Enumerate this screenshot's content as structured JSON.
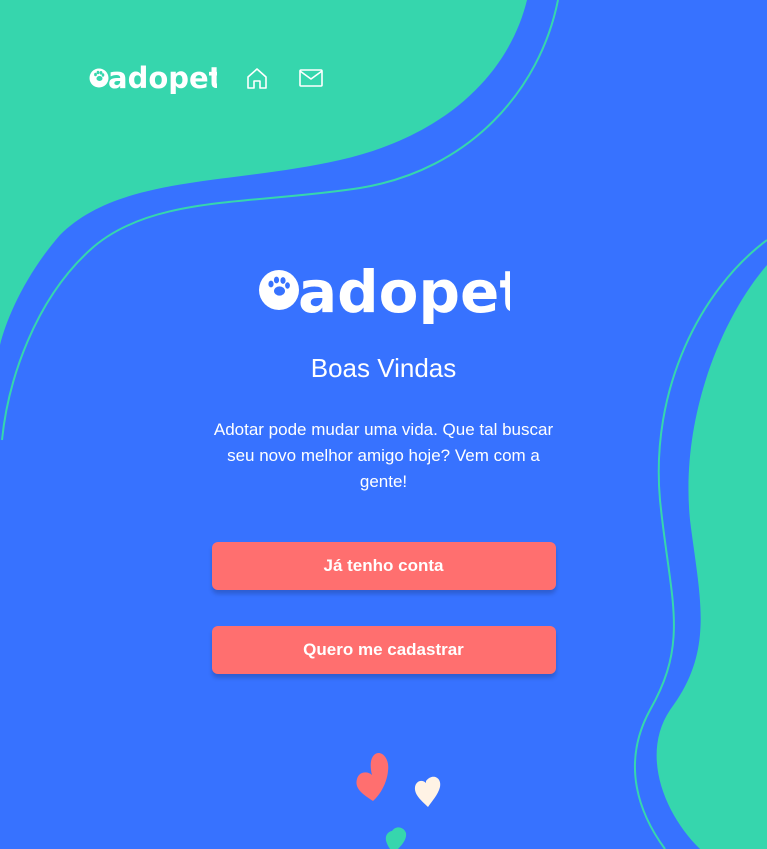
{
  "brand": {
    "logo_text": "adopet",
    "colors": {
      "background": "#3772FF",
      "accent_green": "#36D6AD",
      "button": "#FF6F6F",
      "text": "#FFFFFF"
    }
  },
  "header": {
    "nav": [
      {
        "icon": "home-icon"
      },
      {
        "icon": "mail-icon"
      }
    ]
  },
  "main": {
    "title": "Boas Vindas",
    "description": "Adotar pode mudar uma vida. Que tal buscar seu novo melhor amigo hoje? Vem com a gente!",
    "buttons": {
      "login_label": "Já tenho conta",
      "signup_label": "Quero me cadastrar"
    }
  },
  "decorations": [
    "heart-icon",
    "heart-icon",
    "heart-icon"
  ]
}
